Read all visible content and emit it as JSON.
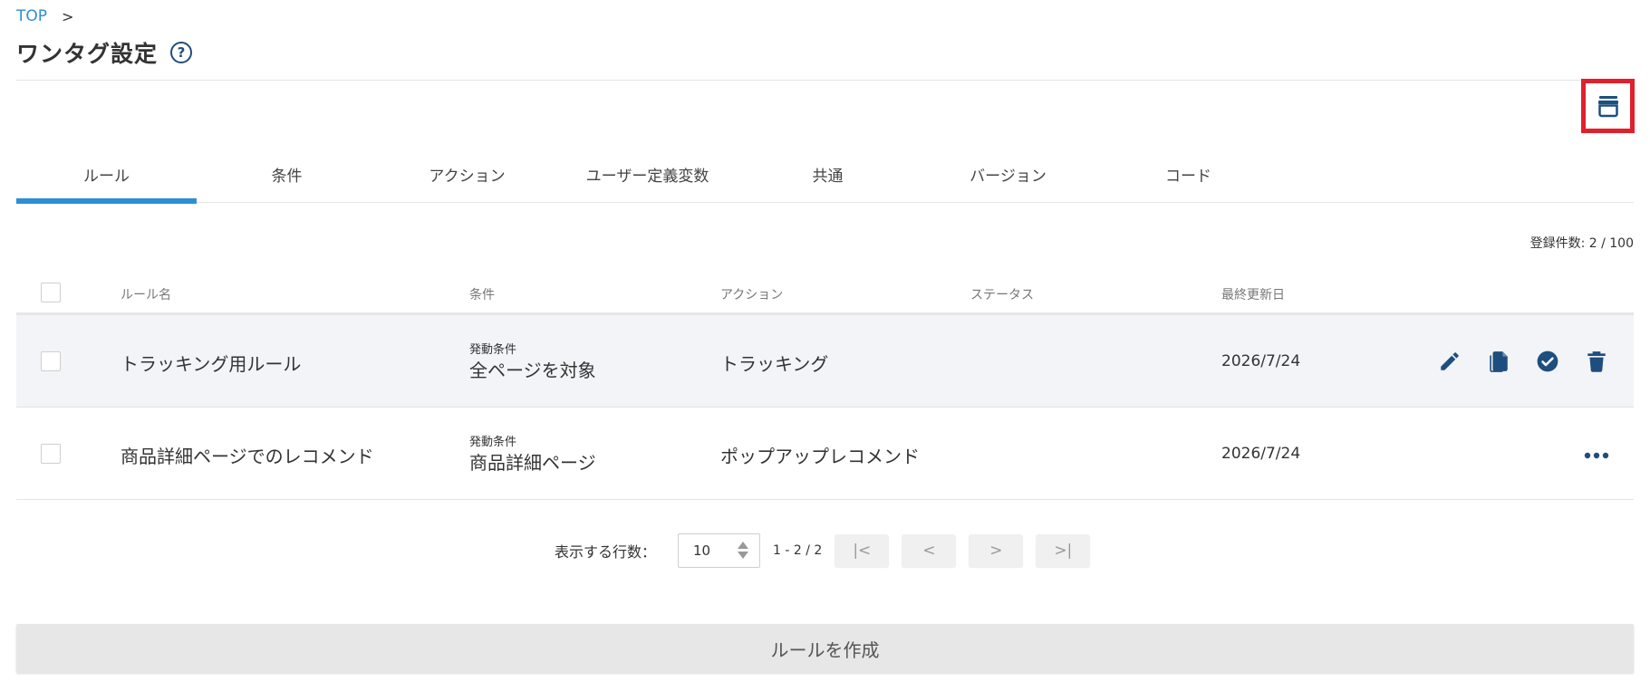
{
  "breadcrumb": {
    "top": "TOP",
    "separator": ">"
  },
  "page": {
    "title": "ワンタグ設定",
    "help": "?"
  },
  "tabs": [
    {
      "label": "ルール",
      "active": true
    },
    {
      "label": "条件",
      "active": false
    },
    {
      "label": "アクション",
      "active": false
    },
    {
      "label": "ユーザー定義変数",
      "active": false
    },
    {
      "label": "共通",
      "active": false
    },
    {
      "label": "バージョン",
      "active": false
    },
    {
      "label": "コード",
      "active": false
    }
  ],
  "count_text": "登録件数: 2 / 100",
  "table": {
    "headers": {
      "name": "ルール名",
      "condition": "条件",
      "action": "アクション",
      "status": "ステータス",
      "updated": "最終更新日"
    },
    "rows": [
      {
        "name": "トラッキング用ルール",
        "condition_label": "発動条件",
        "condition": "全ページを対象",
        "action": "トラッキング",
        "status": "",
        "updated": "2026/7/24"
      },
      {
        "name": "商品詳細ページでのレコメンド",
        "condition_label": "発動条件",
        "condition": "商品詳細ページ",
        "action": "ポップアップレコメンド",
        "status": "",
        "updated": "2026/7/24"
      }
    ]
  },
  "pager": {
    "rows_label": "表示する行数：",
    "rows_value": "10",
    "range": "1 - 2 / 2",
    "first": "|<",
    "prev": "<",
    "next": ">",
    "last": ">|"
  },
  "create_button": "ルールを作成",
  "icons": {
    "archive": "archive-icon",
    "help": "help-circle-icon",
    "edit": "pencil-icon",
    "copy": "document-icon",
    "check": "check-circle-icon",
    "delete": "trash-icon",
    "more": "more-horizontal-icon"
  },
  "colors": {
    "accent": "#2d8fd5",
    "icon": "#1e4e7e",
    "highlight_border": "#e0202c",
    "row_highlight": "#f2f4f8"
  }
}
